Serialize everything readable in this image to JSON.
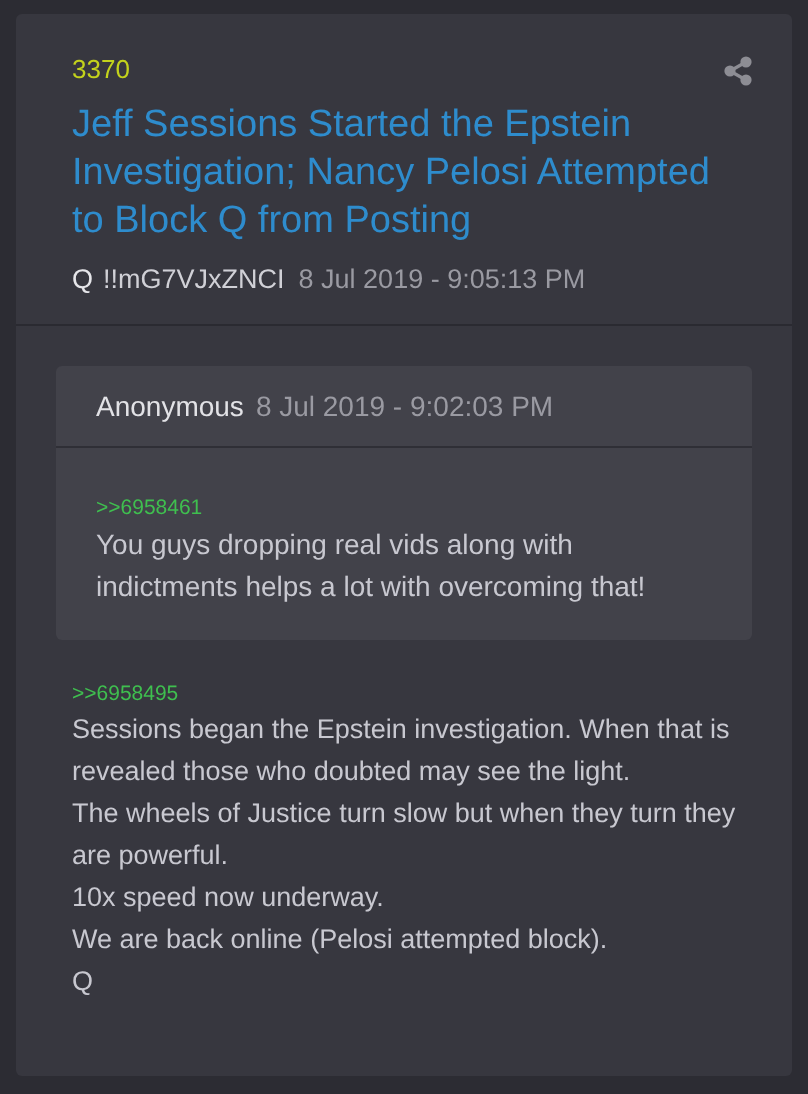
{
  "post": {
    "number": "3370",
    "title": "Jeff Sessions Started the Epstein Investigation; Nancy Pelosi Attempted to Block Q from Posting",
    "author": "Q",
    "tripcode": "!!mG7VJxZNCI",
    "timestamp": "8 Jul 2019 - 9:05:13 PM",
    "quote": {
      "author": "Anonymous",
      "timestamp": "8 Jul 2019 - 9:02:03 PM",
      "reference": ">>6958461",
      "lines": [
        "You guys dropping real vids along with indictments helps a lot with overcoming that!"
      ]
    },
    "reference": ">>6958495",
    "lines": [
      "Sessions began the Epstein investigation. When that is revealed those who doubted may see the light.",
      "The wheels of Justice turn slow but when they turn they are powerful.",
      "10x speed now underway.",
      "We are back online (Pelosi attempted block).",
      "Q"
    ]
  }
}
